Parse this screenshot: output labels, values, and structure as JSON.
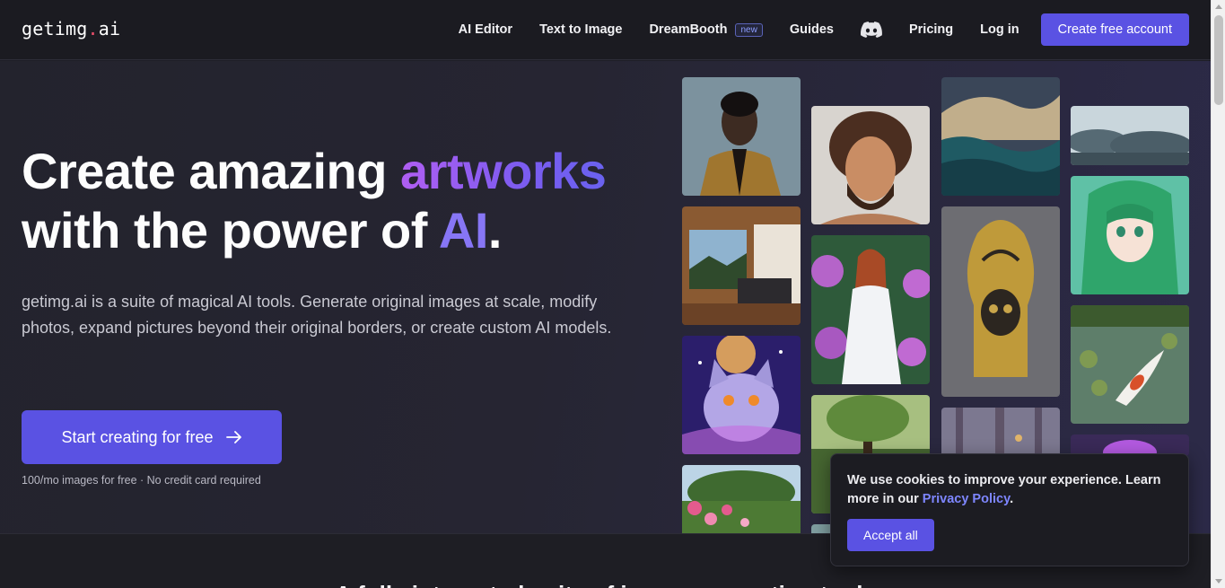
{
  "nav": {
    "logo_main": "getimg",
    "logo_dot": ".",
    "logo_tld": "ai",
    "links": {
      "ai_editor": "AI Editor",
      "text_to_image": "Text to Image",
      "dreambooth": "DreamBooth",
      "dreambooth_badge": "new",
      "guides": "Guides",
      "pricing": "Pricing",
      "login": "Log in"
    },
    "discord_icon": "discord-icon",
    "cta": "Create free account"
  },
  "hero": {
    "headline_part1": "Create amazing ",
    "headline_highlight": "artworks",
    "headline_part2": "with the power of ",
    "headline_ai": "AI",
    "headline_period": ".",
    "lead": "getimg.ai is a suite of magical AI tools. Generate original images at scale, modify photos, expand pictures beyond their original borders, or create custom AI models.",
    "cta": "Start creating for free",
    "cta_icon": "arrow-right-icon",
    "note": "100/mo images for free · No credit card required"
  },
  "gallery": [
    {
      "name": "portrait-man-coat"
    },
    {
      "name": "wooden-bedroom"
    },
    {
      "name": "cosmic-cat"
    },
    {
      "name": "rose-garden"
    },
    {
      "name": "curly-haired-man"
    },
    {
      "name": "woman-flowers-dress"
    },
    {
      "name": "forest-path"
    },
    {
      "name": "stormy-sea"
    },
    {
      "name": "golden-skull-ornament"
    },
    {
      "name": "misty-forest"
    },
    {
      "name": "clouds-landscape"
    },
    {
      "name": "green-haired-anime-girl"
    },
    {
      "name": "koi-pond"
    },
    {
      "name": "purple-art"
    }
  ],
  "section2": {
    "title": "A fully integrated suite of image generation tools"
  },
  "cookie": {
    "text": "We use cookies to improve your experience. Learn more in our ",
    "link": "Privacy Policy",
    "period": ".",
    "accept": "Accept all"
  },
  "colors": {
    "accent": "#5a52e3",
    "link": "#7e86ff",
    "highlight_start": "#b05ef2",
    "highlight_end": "#6a62ef"
  }
}
